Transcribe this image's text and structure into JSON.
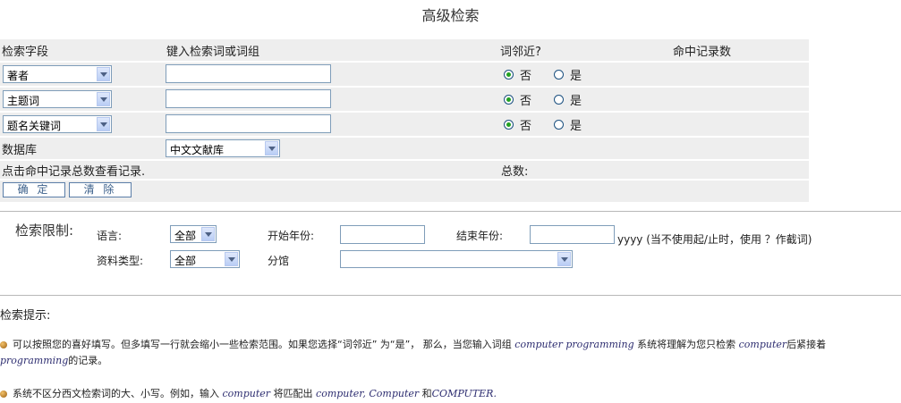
{
  "page_title": "高级检索",
  "table": {
    "headers": {
      "field": "检索字段",
      "term": "键入检索词或词组",
      "proximity": "词邻近?",
      "hits": "命中记录数"
    },
    "rows": [
      {
        "field": "著者",
        "term": "",
        "no_label": "否",
        "yes_label": "是",
        "selected": "no"
      },
      {
        "field": "主题词",
        "term": "",
        "no_label": "否",
        "yes_label": "是",
        "selected": "no"
      },
      {
        "field": "题名关键词",
        "term": "",
        "no_label": "否",
        "yes_label": "是",
        "selected": "no"
      }
    ],
    "database_label": "数据库",
    "database_value": "中文文献库",
    "hint": "点击命中记录总数查看记录.",
    "total_label": "总数:",
    "confirm_button": "确 定",
    "clear_button": "清 除"
  },
  "limits": {
    "label": "检索限制:",
    "language_label": "语言:",
    "language_value": "全部",
    "start_year_label": "开始年份:",
    "start_year_value": "",
    "end_year_label": "结束年份:",
    "end_year_value": "",
    "year_note": "yyyy (当不使用起/止时，使用 ？作截词)",
    "type_label": "资料类型:",
    "type_value": "全部",
    "branch_label": "分馆",
    "branch_value": ""
  },
  "tips": {
    "heading": "检索提示:",
    "tip1_a": "可以按照您的喜好填写。但多填写一行就会缩小一些检索范围。如果您选择“词邻近” 为“是”， 那么，当您输入词组",
    "tip1_term": "computer programming",
    "tip1_b": "系统将理解为您只检索",
    "tip1_word1": "computer",
    "tip1_c": "后紧接着",
    "tip1_word2": "programming",
    "tip1_d": "的记录。",
    "tip2_a": "系统不区分西文检索词的大、小写。例如，输入",
    "tip2_word": "computer",
    "tip2_b": "将匹配出",
    "tip2_matches": "computer, Computer",
    "tip2_and": "和",
    "tip2_upper": "COMPUTER."
  }
}
